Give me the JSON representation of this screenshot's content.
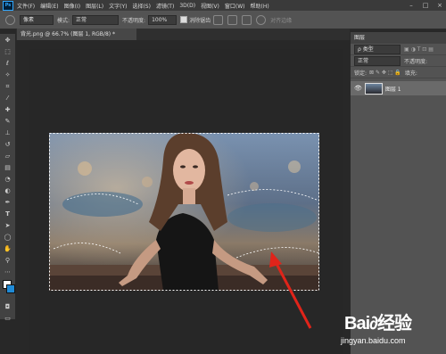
{
  "menubar": {
    "logo": "Ps",
    "items": [
      "文件(F)",
      "编辑(E)",
      "图像(I)",
      "图层(L)",
      "文字(Y)",
      "选择(S)",
      "滤镜(T)",
      "3D(D)",
      "视图(V)",
      "窗口(W)",
      "帮助(H)"
    ]
  },
  "options": {
    "px_value": "像素",
    "mode_label": "模式:",
    "mode_value": "正常",
    "opacity_label": "不透明度:",
    "opacity_value": "100%",
    "antialias_label": "消除锯齿",
    "align_label": "对齐边缘"
  },
  "document": {
    "tab_title": "背光.png @ 66.7% (图层 1, RGB/8) *"
  },
  "layers_panel": {
    "title": "图层",
    "filter_kind": "ρ 类型",
    "blend_mode": "正常",
    "opacity_label": "不透明度:",
    "lock_label": "锁定:",
    "fill_label": "填充:",
    "layer_name": "图层 1"
  },
  "watermark": {
    "brand": "Bai∂经验",
    "url": "jingyan.baidu.com"
  },
  "colors": {
    "arrow": "#e0241a",
    "accent": "#31a8ff"
  }
}
